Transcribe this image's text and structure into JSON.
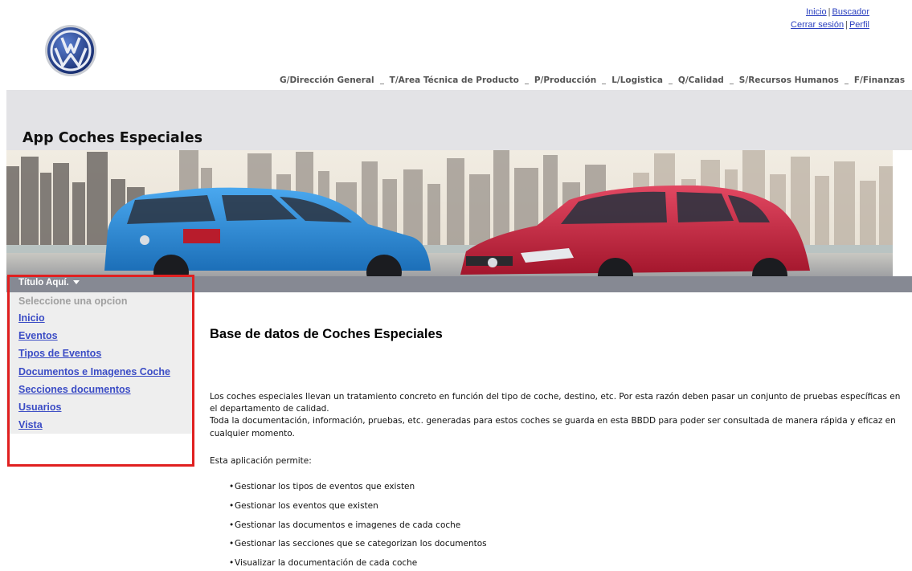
{
  "top_links": {
    "inicio": "Inicio",
    "buscador": "Buscador",
    "cerrar_sesion": "Cerrar sesión",
    "perfil": "Perfil",
    "separator": "|"
  },
  "logo": {
    "icon": "vw-logo",
    "color": "#1f3a8a"
  },
  "dept_nav": [
    "G/Dirección General",
    "T/Area Técnica de Producto",
    "P/Producción",
    "L/Logistica",
    "Q/Calidad",
    "S/Recursos Humanos",
    "F/Finanzas"
  ],
  "app_title": "App Coches Especiales",
  "menu": {
    "title": "Título Aquí.",
    "placeholder": "Seleccione una opcion",
    "items": [
      "Inicio",
      "Eventos",
      "Tipos de Eventos",
      "Documentos e Imagenes Coche",
      "Secciones documentos",
      "Usuarios",
      "Vista"
    ],
    "highlight_color": "#e02020"
  },
  "main": {
    "title": "Base de datos de Coches Especiales",
    "paragraph1": "Los coches especiales llevan un tratamiento concreto en función del tipo de coche, destino, etc. Por esta razón deben pasar un conjunto de pruebas específicas en el departamento de calidad.",
    "paragraph2": "Toda la documentación, información, pruebas, etc. generadas para estos coches se guarda en esta BBDD para poder ser consultada de manera rápida y eficaz en cualquier momento.",
    "intro": "Esta aplicación permite:",
    "bullets": [
      "Gestionar los tipos de eventos que existen",
      "Gestionar los eventos que existen",
      "Gestionar las documentos e imagenes de cada coche",
      "Gestionar las secciones que se categorizan los documentos",
      "Visualizar la documentación de cada coche"
    ]
  },
  "banner": {
    "left_car_color": "#2b8fd8",
    "right_car_color": "#c8203a"
  }
}
